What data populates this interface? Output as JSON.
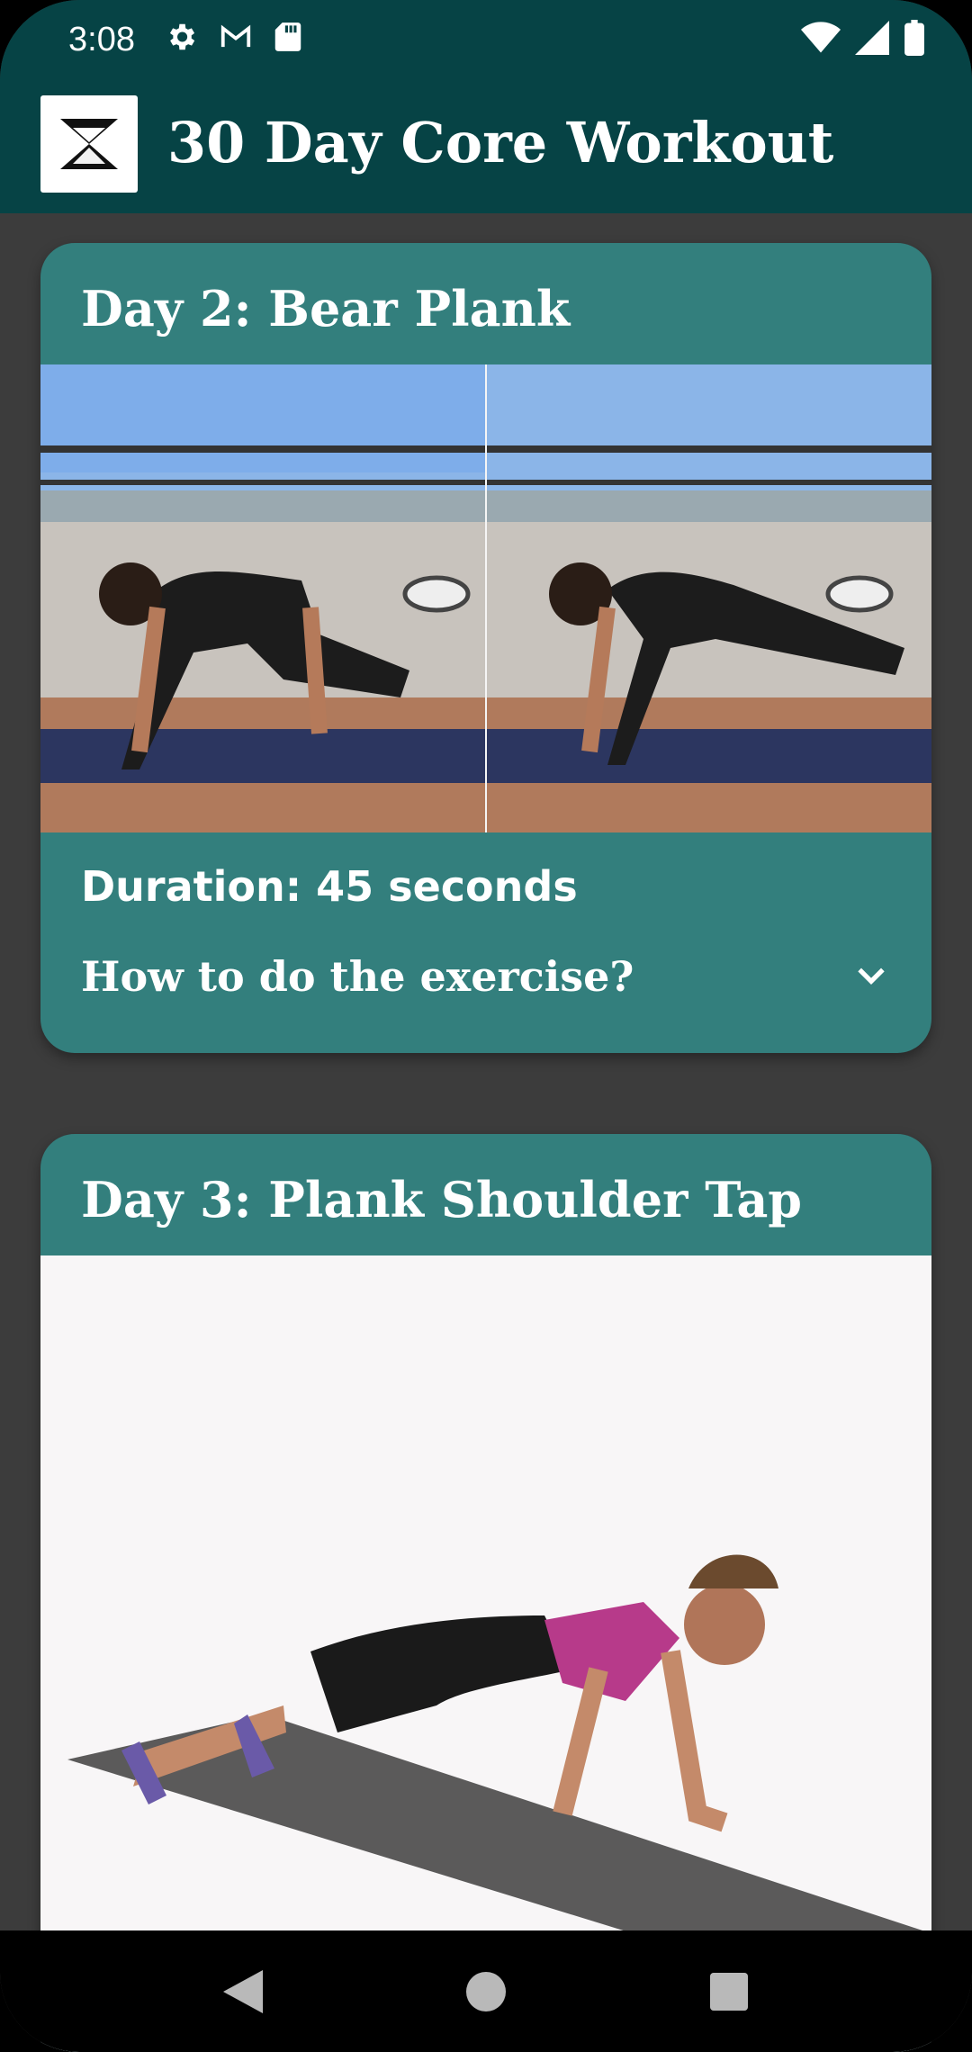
{
  "status_bar": {
    "time": "3:08",
    "left_icons": [
      "gear-icon",
      "gmail-icon",
      "sd-card-icon"
    ],
    "right_icons": [
      "wifi-icon",
      "signal-icon",
      "battery-icon"
    ]
  },
  "app_bar": {
    "title": "30 Day Core Workout",
    "logo_icon": "hourglass-logo-icon"
  },
  "cards": [
    {
      "title": "Day 2: Bear Plank",
      "image_alt": "bear plank exercise photos",
      "duration": "Duration: 45 seconds",
      "howto": "How to do the exercise?",
      "expand_icon": "chevron-down-icon"
    },
    {
      "title": "Day 3: Plank Shoulder Tap",
      "image_alt": "plank shoulder tap exercise photo"
    }
  ],
  "nav_bar": {
    "back_icon": "back-triangle-icon",
    "home_icon": "home-circle-icon",
    "recents_icon": "recents-square-icon"
  },
  "colors": {
    "app_bar": "#064345",
    "card": "#337f7d",
    "background": "#3c3c3c"
  }
}
